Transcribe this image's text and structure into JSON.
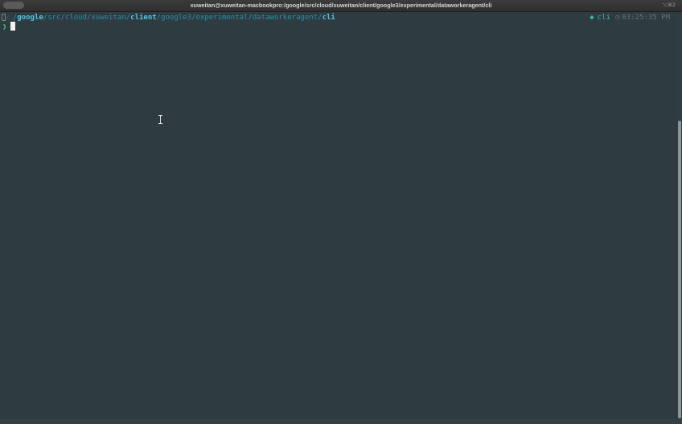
{
  "window": {
    "title": "xuweitan@xuweitan-macbookpro:/google/src/cloud/xuweitan/client/google3/experimental/dataworkeragent/cli",
    "titlebar_right": "⌥⌘2"
  },
  "prompt": {
    "apple_icon": "",
    "home_icon": "⌂",
    "path_segments": [
      {
        "text": "/",
        "style": "sep"
      },
      {
        "text": "google",
        "style": "bold"
      },
      {
        "text": "/src/cloud/xuweitan/",
        "style": "dim"
      },
      {
        "text": "client",
        "style": "bold"
      },
      {
        "text": "/google3/experimental/dataworkeragent/",
        "style": "dim"
      },
      {
        "text": "cli",
        "style": "bold"
      }
    ],
    "right": {
      "dir_icon": "◆",
      "dir_name": "cli",
      "clock_icon": "◷",
      "time": "03:25:35 PM"
    },
    "prompt_char": "❯"
  },
  "colors": {
    "background": "#2e3b40",
    "path_dim": "#2b8fa6",
    "path_bold": "#4fc8e6",
    "prompt_green": "#3fd08a",
    "dir_teal": "#3fb8b0"
  }
}
